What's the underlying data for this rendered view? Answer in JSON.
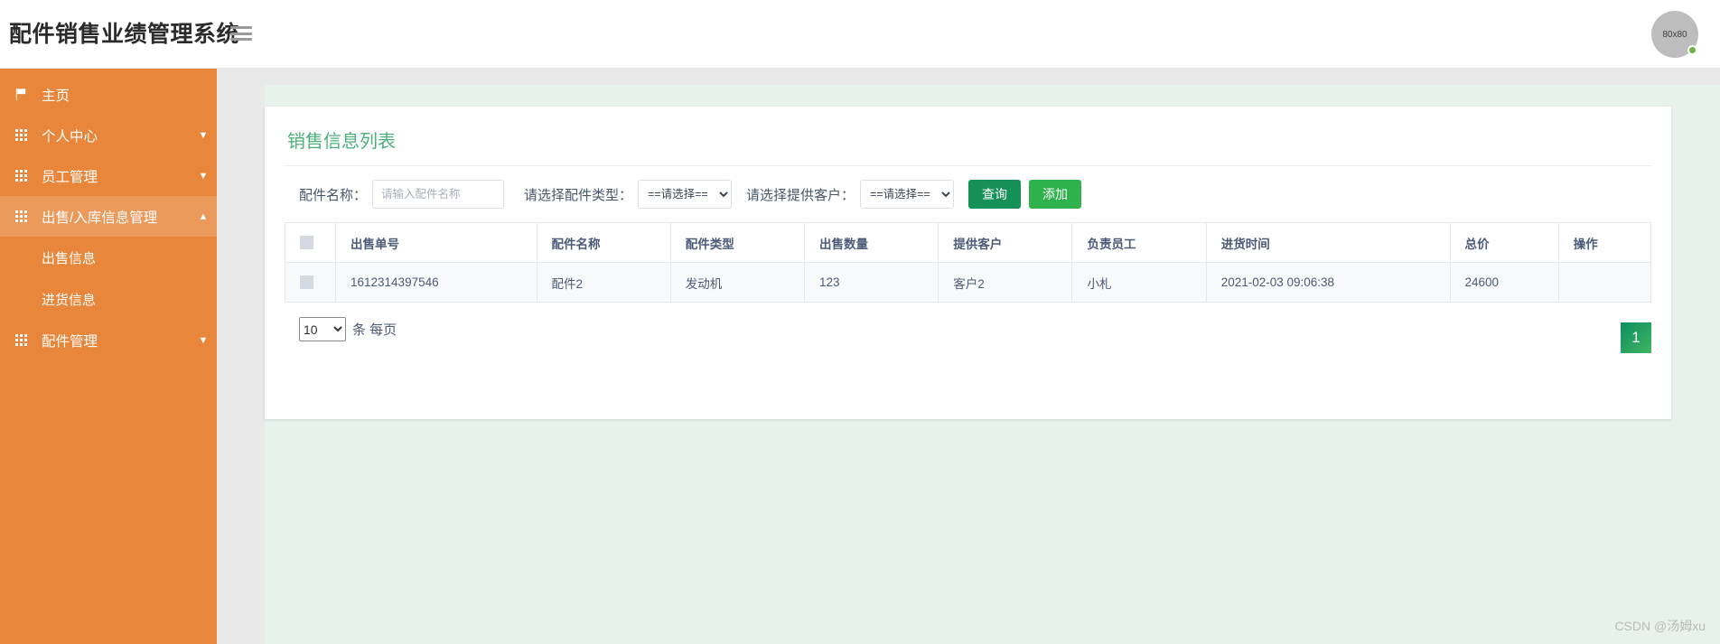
{
  "header": {
    "brand_title": "配件销售业绩管理系统",
    "menu_toggle_icon": "hamburger-icon",
    "avatar_text": "80x80"
  },
  "sidebar": {
    "items": [
      {
        "label": "主页",
        "icon": "flag-icon",
        "caret": "",
        "active": false
      },
      {
        "label": "个人中心",
        "icon": "grid-icon",
        "caret": "▼",
        "active": false
      },
      {
        "label": "员工管理",
        "icon": "grid-icon",
        "caret": "▼",
        "active": false
      },
      {
        "label": "出售/入库信息管理",
        "icon": "grid-icon",
        "caret": "▲",
        "active": true
      },
      {
        "label": "配件管理",
        "icon": "grid-icon",
        "caret": "▼",
        "active": false
      }
    ],
    "subitems": [
      {
        "label": "出售信息"
      },
      {
        "label": "进货信息"
      }
    ]
  },
  "main": {
    "card_title": "销售信息列表",
    "search": {
      "name_label": "配件名称：",
      "name_placeholder": "请输入配件名称",
      "name_value": "",
      "type_label": "请选择配件类型：",
      "type_value": "==请选择==",
      "customer_label": "请选择提供客户：",
      "customer_value": "==请选择==",
      "query_button": "查询",
      "add_button": "添加"
    },
    "table": {
      "columns": [
        "出售单号",
        "配件名称",
        "配件类型",
        "出售数量",
        "提供客户",
        "负责员工",
        "进货时间",
        "总价",
        "操作"
      ],
      "rows": [
        {
          "order_no": "1612314397546",
          "part_name": "配件2",
          "part_type": "发动机",
          "quantity": "123",
          "customer": "客户2",
          "employee": "小札",
          "purchase_time": "2021-02-03 09:06:38",
          "total_price": "24600",
          "actions": ""
        }
      ]
    },
    "pagination": {
      "page_size": "10",
      "per_page_text": "条 每页",
      "current_page": "1"
    }
  },
  "watermark": "CSDN @汤姆xu",
  "colors": {
    "sidebar": "#e8873b",
    "sidebar_active": "#eb9a5c",
    "title_green": "#4bb07a",
    "query_green": "#159157",
    "add_green": "#2eb24c",
    "status_dot": "#6cb33f"
  }
}
